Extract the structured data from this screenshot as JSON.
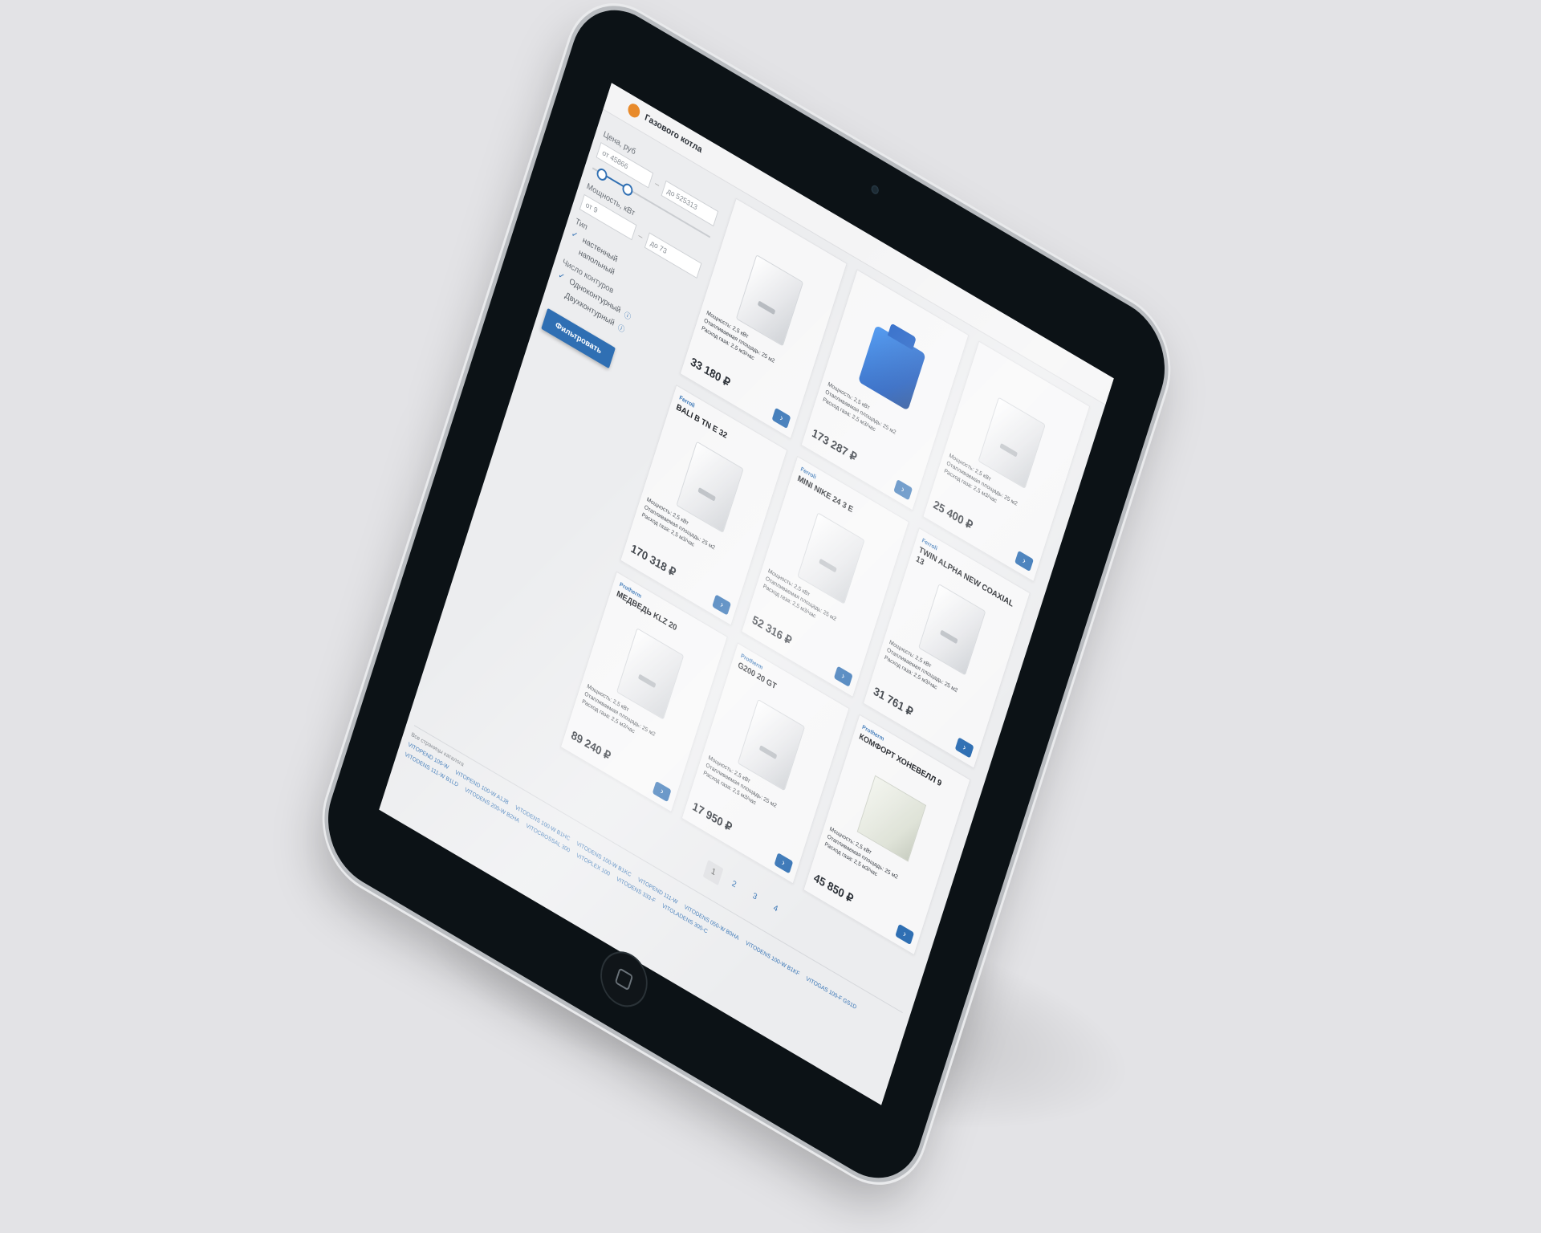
{
  "page": {
    "category_title": "Газового котла"
  },
  "filters": {
    "price_label": "Цена, руб",
    "price_from": "от 45866",
    "price_to": "до 525313",
    "power_label": "Мощность, кВт",
    "power_from": "от 9",
    "power_to": "до 73",
    "type_label": "Тип",
    "type_options": [
      {
        "label": "настенный",
        "checked": true
      },
      {
        "label": "напольный",
        "checked": false
      }
    ],
    "circuits_label": "Число контуров",
    "circuit_options": [
      {
        "label": "Одноконтурный",
        "checked": true
      },
      {
        "label": "Двухконтурный",
        "checked": false
      }
    ],
    "submit_label": "Фильтровать"
  },
  "products": [
    {
      "brand": "",
      "name": "",
      "specs": [
        "Мощность: 2,5 кВт",
        "Отапливаемая площадь: 25 м2",
        "Расход газа: 2,5 м3/час"
      ],
      "price": "33 180 ₽",
      "image": "white"
    },
    {
      "brand": "",
      "name": "",
      "specs": [
        "Мощность: 2,5 кВт",
        "Отапливаемая площадь: 25 м2",
        "Расход газа: 2,5 м3/час"
      ],
      "price": "173 287 ₽",
      "image": "blue"
    },
    {
      "brand": "",
      "name": "",
      "specs": [
        "Мощность: 2,5 кВт",
        "Отапливаемая площадь: 25 м2",
        "Расход газа: 2,5 м3/час"
      ],
      "price": "25 400 ₽",
      "image": "white"
    },
    {
      "brand": "Ferroli",
      "name": "Bali B TN E 32",
      "specs": [
        "Мощность: 2,5 кВт",
        "Отапливаемая площадь: 25 м2",
        "Расход газа: 2,5 м3/час"
      ],
      "price": "170 318 ₽",
      "image": "white"
    },
    {
      "brand": "Ferroli",
      "name": "Mini Nike 24 3 E",
      "specs": [
        "Мощность: 2,5 кВт",
        "Отапливаемая площадь: 25 м2",
        "Расход газа: 2,5 м3/час"
      ],
      "price": "52 316 ₽",
      "image": "white"
    },
    {
      "brand": "Ferroli",
      "name": "Twin Alpha New Coaxial 13",
      "specs": [
        "Мощность: 2,5 кВт",
        "Отапливаемая площадь: 25 м2",
        "Расход газа: 2,5 м3/час"
      ],
      "price": "31 761 ₽",
      "image": "white"
    },
    {
      "brand": "Protherm",
      "name": "Медведь KLZ 20",
      "specs": [
        "Мощность: 2,5 кВт",
        "Отапливаемая площадь: 25 м2",
        "Расход газа: 2,5 м3/час"
      ],
      "price": "89 240 ₽",
      "image": "white"
    },
    {
      "brand": "Protherm",
      "name": "G200 20 GT",
      "specs": [
        "Мощность: 2,5 кВт",
        "Отапливаемая площадь: 25 м2",
        "Расход газа: 2,5 м3/час"
      ],
      "price": "17 950 ₽",
      "image": "white"
    },
    {
      "brand": "Protherm",
      "name": "Комфорт Хоневелл 9",
      "specs": [
        "Мощность: 2,5 кВт",
        "Отапливаемая площадь: 25 м2",
        "Расход газа: 2,5 м3/час"
      ],
      "price": "45 850 ₽",
      "image": "cream"
    }
  ],
  "pagination": {
    "pages": [
      "1",
      "2",
      "3",
      "4"
    ],
    "current": "1"
  },
  "footer": {
    "header": "Все страницы каталога",
    "links": [
      "VITOPEND 100-W",
      "VITOPEND 100-W A1JB",
      "VITODENS 100-W B1HC",
      "VITODENS 100-W B1KC",
      "VITOPEND 111-W",
      "VITODENS 050-W B0HA",
      "VITODENS 100-W B1KF",
      "VITOGAS 100-F GS1D",
      "VITODENS 111-W B1LD",
      "VITODENS 200-W B2HA",
      "VITOCROSSAL 300",
      "VITOPLEX 100",
      "VITODENS 333-F",
      "VITOLADENS 300-C"
    ]
  }
}
